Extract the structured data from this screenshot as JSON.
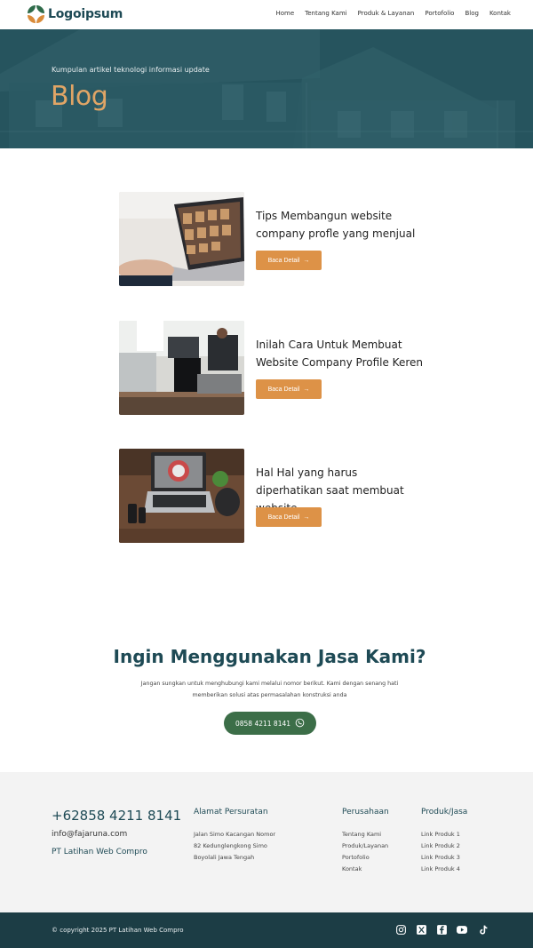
{
  "header": {
    "logo_text": "Logoipsum",
    "nav": [
      "Home",
      "Tentang Kami",
      "Produk & Layanan",
      "Portofolio",
      "Blog",
      "Kontak"
    ]
  },
  "hero": {
    "subtitle": "Kumpulan artikel teknologi informasi update",
    "title": "Blog"
  },
  "articles": [
    {
      "title": "Tips Membangun website company profle yang menjual",
      "button": "Baca Detail"
    },
    {
      "title": "Inilah Cara Untuk Membuat Website Company Profile Keren",
      "button": "Baca Detail"
    },
    {
      "title": "Hal Hal yang harus diperhatikan saat membuat website",
      "button": "Baca Detail"
    }
  ],
  "cta": {
    "title": "Ingin Menggunakan Jasa Kami?",
    "description": "Jangan sungkan untuk menghubungi kami melalui nomor berikut. Kami dengan senang hati memberikan solusi atas permasalahan konstruksi anda",
    "button": "0858 4211 8141"
  },
  "footer": {
    "phone": "+62858 4211 8141",
    "email": "info@fajaruna.com",
    "company": "PT Latihan Web Compro",
    "address": {
      "heading": "Alamat Persuratan",
      "lines": [
        "Jalan Simo Kacangan Nomor",
        "82 Kedunglengkong Simo",
        "Boyolali Jawa Tengah"
      ]
    },
    "perusahaan": {
      "heading": "Perusahaan",
      "links": [
        "Tentang Kami",
        "Produk/Layanan",
        "Portofolio",
        "Kontak"
      ]
    },
    "produk": {
      "heading": "Produk/Jasa",
      "links": [
        "Link Produk 1",
        "Link Produk 2",
        "Link Produk 3",
        "Link Produk 4"
      ]
    }
  },
  "bottom": {
    "copyright": "© copyright 2025 PT Latihan Web Compro",
    "socials": [
      "instagram-icon",
      "x-icon",
      "facebook-icon",
      "youtube-icon",
      "tiktok-icon"
    ]
  },
  "colors": {
    "accent": "#dd9247",
    "primary": "#1e4a55",
    "cta_green": "#3c6e48",
    "bottom_bar": "#1c3d45"
  }
}
